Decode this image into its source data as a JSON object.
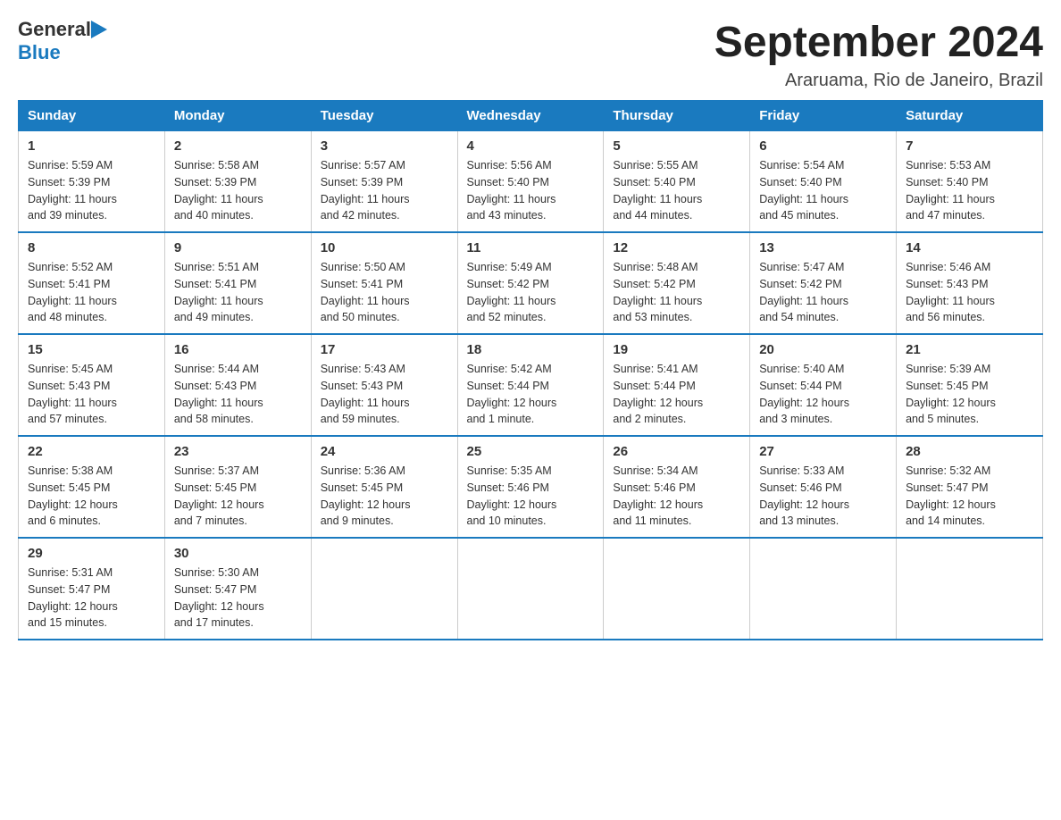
{
  "header": {
    "logo_general": "General",
    "logo_blue": "Blue",
    "month_title": "September 2024",
    "location": "Araruama, Rio de Janeiro, Brazil"
  },
  "days_of_week": [
    "Sunday",
    "Monday",
    "Tuesday",
    "Wednesday",
    "Thursday",
    "Friday",
    "Saturday"
  ],
  "weeks": [
    [
      {
        "day": "1",
        "sunrise": "5:59 AM",
        "sunset": "5:39 PM",
        "daylight": "11 hours and 39 minutes."
      },
      {
        "day": "2",
        "sunrise": "5:58 AM",
        "sunset": "5:39 PM",
        "daylight": "11 hours and 40 minutes."
      },
      {
        "day": "3",
        "sunrise": "5:57 AM",
        "sunset": "5:39 PM",
        "daylight": "11 hours and 42 minutes."
      },
      {
        "day": "4",
        "sunrise": "5:56 AM",
        "sunset": "5:40 PM",
        "daylight": "11 hours and 43 minutes."
      },
      {
        "day": "5",
        "sunrise": "5:55 AM",
        "sunset": "5:40 PM",
        "daylight": "11 hours and 44 minutes."
      },
      {
        "day": "6",
        "sunrise": "5:54 AM",
        "sunset": "5:40 PM",
        "daylight": "11 hours and 45 minutes."
      },
      {
        "day": "7",
        "sunrise": "5:53 AM",
        "sunset": "5:40 PM",
        "daylight": "11 hours and 47 minutes."
      }
    ],
    [
      {
        "day": "8",
        "sunrise": "5:52 AM",
        "sunset": "5:41 PM",
        "daylight": "11 hours and 48 minutes."
      },
      {
        "day": "9",
        "sunrise": "5:51 AM",
        "sunset": "5:41 PM",
        "daylight": "11 hours and 49 minutes."
      },
      {
        "day": "10",
        "sunrise": "5:50 AM",
        "sunset": "5:41 PM",
        "daylight": "11 hours and 50 minutes."
      },
      {
        "day": "11",
        "sunrise": "5:49 AM",
        "sunset": "5:42 PM",
        "daylight": "11 hours and 52 minutes."
      },
      {
        "day": "12",
        "sunrise": "5:48 AM",
        "sunset": "5:42 PM",
        "daylight": "11 hours and 53 minutes."
      },
      {
        "day": "13",
        "sunrise": "5:47 AM",
        "sunset": "5:42 PM",
        "daylight": "11 hours and 54 minutes."
      },
      {
        "day": "14",
        "sunrise": "5:46 AM",
        "sunset": "5:43 PM",
        "daylight": "11 hours and 56 minutes."
      }
    ],
    [
      {
        "day": "15",
        "sunrise": "5:45 AM",
        "sunset": "5:43 PM",
        "daylight": "11 hours and 57 minutes."
      },
      {
        "day": "16",
        "sunrise": "5:44 AM",
        "sunset": "5:43 PM",
        "daylight": "11 hours and 58 minutes."
      },
      {
        "day": "17",
        "sunrise": "5:43 AM",
        "sunset": "5:43 PM",
        "daylight": "11 hours and 59 minutes."
      },
      {
        "day": "18",
        "sunrise": "5:42 AM",
        "sunset": "5:44 PM",
        "daylight": "12 hours and 1 minute."
      },
      {
        "day": "19",
        "sunrise": "5:41 AM",
        "sunset": "5:44 PM",
        "daylight": "12 hours and 2 minutes."
      },
      {
        "day": "20",
        "sunrise": "5:40 AM",
        "sunset": "5:44 PM",
        "daylight": "12 hours and 3 minutes."
      },
      {
        "day": "21",
        "sunrise": "5:39 AM",
        "sunset": "5:45 PM",
        "daylight": "12 hours and 5 minutes."
      }
    ],
    [
      {
        "day": "22",
        "sunrise": "5:38 AM",
        "sunset": "5:45 PM",
        "daylight": "12 hours and 6 minutes."
      },
      {
        "day": "23",
        "sunrise": "5:37 AM",
        "sunset": "5:45 PM",
        "daylight": "12 hours and 7 minutes."
      },
      {
        "day": "24",
        "sunrise": "5:36 AM",
        "sunset": "5:45 PM",
        "daylight": "12 hours and 9 minutes."
      },
      {
        "day": "25",
        "sunrise": "5:35 AM",
        "sunset": "5:46 PM",
        "daylight": "12 hours and 10 minutes."
      },
      {
        "day": "26",
        "sunrise": "5:34 AM",
        "sunset": "5:46 PM",
        "daylight": "12 hours and 11 minutes."
      },
      {
        "day": "27",
        "sunrise": "5:33 AM",
        "sunset": "5:46 PM",
        "daylight": "12 hours and 13 minutes."
      },
      {
        "day": "28",
        "sunrise": "5:32 AM",
        "sunset": "5:47 PM",
        "daylight": "12 hours and 14 minutes."
      }
    ],
    [
      {
        "day": "29",
        "sunrise": "5:31 AM",
        "sunset": "5:47 PM",
        "daylight": "12 hours and 15 minutes."
      },
      {
        "day": "30",
        "sunrise": "5:30 AM",
        "sunset": "5:47 PM",
        "daylight": "12 hours and 17 minutes."
      },
      null,
      null,
      null,
      null,
      null
    ]
  ],
  "labels": {
    "sunrise": "Sunrise:",
    "sunset": "Sunset:",
    "daylight": "Daylight:"
  },
  "colors": {
    "header_bg": "#1a7abf",
    "header_border": "#1a7abf",
    "row_border": "#1a7abf"
  }
}
